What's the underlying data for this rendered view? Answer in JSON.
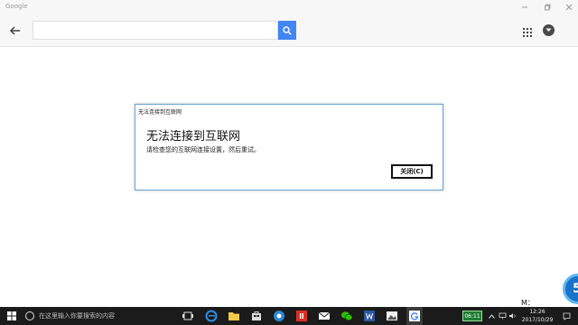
{
  "window": {
    "title": "Google"
  },
  "toolbar": {
    "search_value": "",
    "search_placeholder": ""
  },
  "dialog": {
    "title": "无法连接到互联网",
    "heading": "无法连接到互联网",
    "message": "请检查您的互联网连接设置，然后重试。",
    "close_label": "关闭(C)"
  },
  "overlay": {
    "badge_text": "5",
    "m_text": "M："
  },
  "taskbar": {
    "search_placeholder": "在这里输入你要搜索的内容",
    "tray_chip": "06:11",
    "time": "12:26",
    "date": "2017/10/29"
  }
}
